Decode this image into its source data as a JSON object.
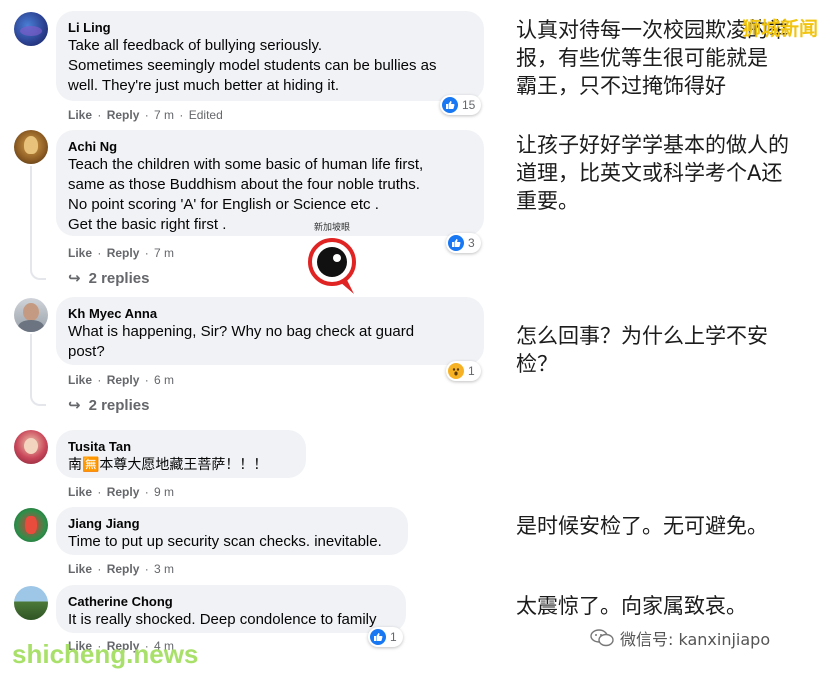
{
  "comments": [
    {
      "author": "Li Ling",
      "lines": [
        "Take all feedback of bullying seriously.",
        "Sometimes seemingly model students can be bullies as",
        "well. They're just much better at hiding it."
      ],
      "like": "Like",
      "reply": "Reply",
      "time": "7 m",
      "edited": "Edited",
      "reaction_count": "15",
      "reaction": "like"
    },
    {
      "author": "Achi Ng",
      "lines": [
        "Teach the children with some basic of human life first,",
        "same as those Buddhism about the four noble truths.",
        "No point scoring 'A' for English or Science etc .",
        "Get the basic right first ."
      ],
      "like": "Like",
      "reply": "Reply",
      "time": "7 m",
      "reaction_count": "3",
      "reaction": "like",
      "replies": "2 replies"
    },
    {
      "author": "Kh Myec Anna",
      "lines": [
        "What is happening, Sir? Why no bag check at guard",
        "post?"
      ],
      "like": "Like",
      "reply": "Reply",
      "time": "6 m",
      "reaction_count": "1",
      "reaction": "wow",
      "replies": "2 replies"
    },
    {
      "author": "Tusita Tan",
      "lines": [
        "南🈚本尊大愿地藏王菩萨！！！"
      ],
      "like": "Like",
      "reply": "Reply",
      "time": "9 m"
    },
    {
      "author": "Jiang Jiang",
      "lines": [
        "Time to put up security scan checks. inevitable."
      ],
      "like": "Like",
      "reply": "Reply",
      "time": "3 m"
    },
    {
      "author": "Catherine Chong",
      "lines": [
        "It is really shocked. Deep condolence to family"
      ],
      "like": "Like",
      "reply": "Reply",
      "time": "4 m",
      "reaction_count": "1",
      "reaction": "like"
    }
  ],
  "translations": {
    "t1": [
      "认真对待每一次校园欺凌的举",
      "报，有些优等生很可能就是",
      "霸王，只不过掩饰得好"
    ],
    "t2": [
      "让孩子好好学学基本的做人的",
      "道理，比英文或科学考个A还",
      "重要。"
    ],
    "t3": [
      "怎么回事？为什么上学不安",
      "检？"
    ],
    "t5": [
      "是时候安检了。无可避免。"
    ],
    "t6": [
      "太震惊了。向家属致哀。"
    ]
  },
  "watermarks": {
    "top_right": "狮城新闻",
    "bottom_left": "shicheng.news",
    "wechat": "微信号: kanxinjiapo",
    "logo_text": "新加坡眼"
  },
  "colors": {
    "bubble": "#f0f2f5",
    "like_blue": "#1877f2",
    "wow_yellow": "#f7b125",
    "meta_gray": "#65676b"
  }
}
